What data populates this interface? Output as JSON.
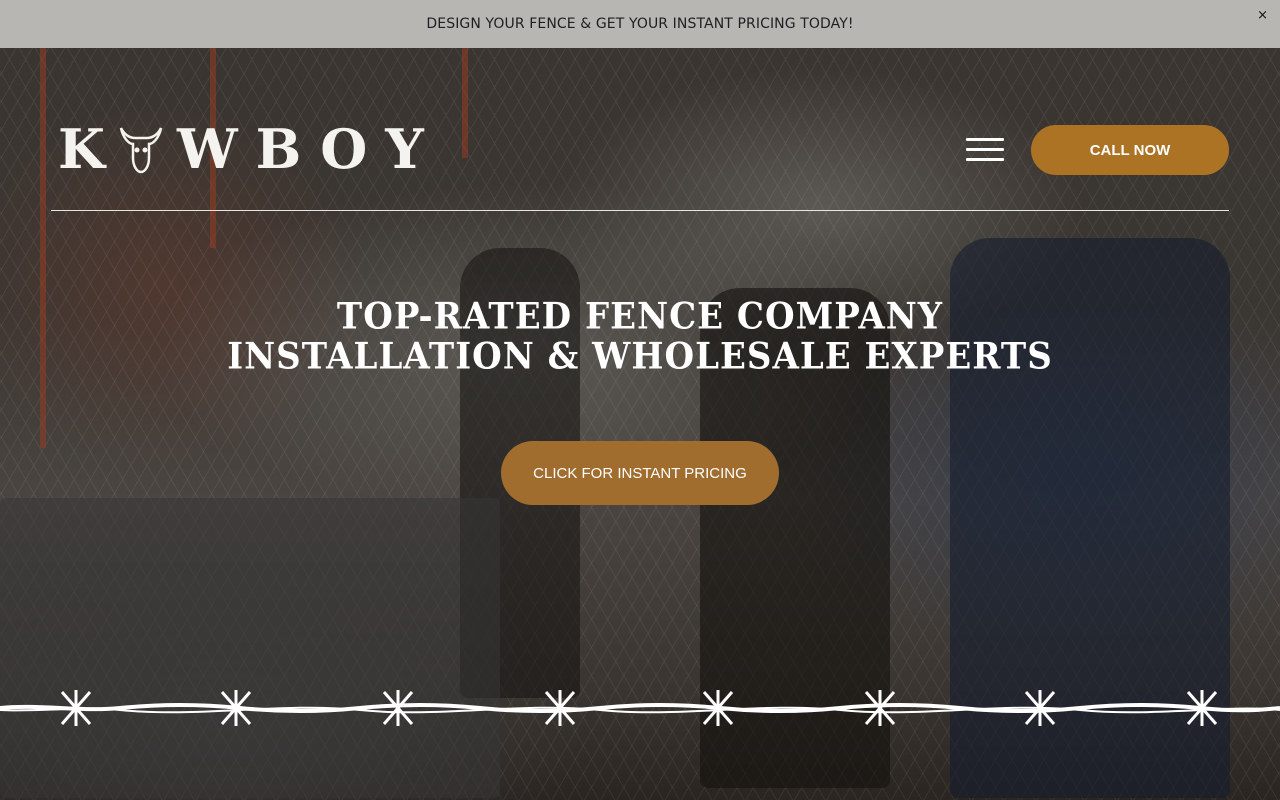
{
  "announcement": {
    "text": "DESIGN YOUR FENCE & GET YOUR INSTANT PRICING TODAY!",
    "close_label": "×"
  },
  "header": {
    "logo_text_left": "K",
    "logo_text_right": "WBOY",
    "logo_icon": "bull-skull-icon",
    "menu_icon": "hamburger-menu-icon",
    "call_button_label": "CALL NOW"
  },
  "hero": {
    "headline_line1": "TOP-RATED FENCE COMPANY",
    "headline_line2": "INSTALLATION & WHOLESALE EXPERTS",
    "cta_label": "CLICK FOR INSTANT PRICING",
    "divider_icon": "barbed-wire-icon"
  },
  "colors": {
    "announcement_bg": "#b8b6b3",
    "accent": "#ad7325",
    "cta": "#a16d2e",
    "text_light": "#ffffff"
  }
}
